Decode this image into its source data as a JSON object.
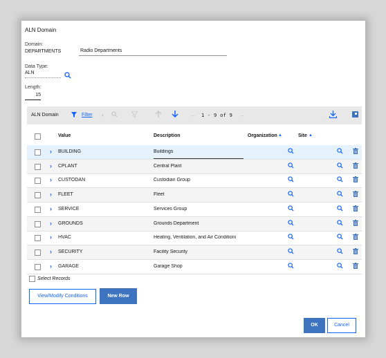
{
  "dialog": {
    "title": "ALN Domain"
  },
  "form": {
    "domain_label": "Domain:",
    "domain_value": "DEPARTMENTS",
    "description_value": "Radio Departments",
    "datatype_label": "Data Type:",
    "datatype_value": "ALN",
    "length_label": "Length:",
    "length_value": "15"
  },
  "table": {
    "toolbar_title": "ALN Domain",
    "filter_label": "Filter",
    "pagination": "1 - 9 of 9",
    "columns": {
      "value": "Value",
      "description": "Description",
      "organization": "Organization",
      "site": "Site"
    },
    "rows": [
      {
        "value": "BUILDING",
        "description": "Buildings"
      },
      {
        "value": "CPLANT",
        "description": "Central Plant"
      },
      {
        "value": "CUSTODAN",
        "description": "Custodian Group"
      },
      {
        "value": "FLEET",
        "description": "Fleet"
      },
      {
        "value": "SERVICE",
        "description": "Services Group"
      },
      {
        "value": "GROUNDS",
        "description": "Grounds Department"
      },
      {
        "value": "HVAC",
        "description": "Heating, Ventilation, and Air Conditioni"
      },
      {
        "value": "SECURITY",
        "description": "Facility Security"
      },
      {
        "value": "GARAGE",
        "description": "Garage Shop"
      }
    ],
    "select_records_label": "Select Records"
  },
  "buttons": {
    "view_modify": "View/Modify Conditions",
    "new_row": "New Row",
    "ok": "OK",
    "cancel": "Cancel"
  },
  "colors": {
    "accent": "#0f62fe",
    "primary_button": "#3e73c0",
    "selected_row": "#e5f2fb"
  },
  "icons": [
    "search-icon",
    "filter-icon",
    "chevron-right-icon",
    "arrow-up-icon",
    "arrow-down-icon",
    "download-icon",
    "settings-icon",
    "trash-icon"
  ]
}
